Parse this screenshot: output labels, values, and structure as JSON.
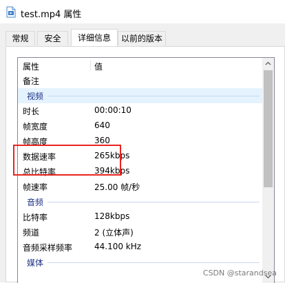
{
  "window": {
    "title": "test.mp4 属性",
    "icon": "video-file-icon"
  },
  "tabs": [
    {
      "label": "常规",
      "active": false
    },
    {
      "label": "安全",
      "active": false
    },
    {
      "label": "详细信息",
      "active": true
    },
    {
      "label": "以前的版本",
      "active": false
    }
  ],
  "details": {
    "columns": {
      "property": "属性",
      "value": "值"
    },
    "rows": {
      "remarks": {
        "name": "备注",
        "value": ""
      },
      "video_group": "视频",
      "duration": {
        "name": "时长",
        "value": "00:00:10"
      },
      "frame_width": {
        "name": "帧宽度",
        "value": "640"
      },
      "frame_height": {
        "name": "帧高度",
        "value": "360"
      },
      "data_rate": {
        "name": "数据速率",
        "value": "265kbps"
      },
      "total_bitrate": {
        "name": "总比特率",
        "value": "394kbps"
      },
      "frame_rate": {
        "name": "帧速率",
        "value": "25.00 帧/秒"
      },
      "audio_group": "音频",
      "bitrate": {
        "name": "比特率",
        "value": "128kbps"
      },
      "channels": {
        "name": "频道",
        "value": "2 (立体声)"
      },
      "sample_rate": {
        "name": "音频采样频率",
        "value": "44.100 kHz"
      },
      "media_group": "媒体"
    }
  },
  "colors": {
    "highlight": "#e8231f",
    "group_text": "#1e3287",
    "selected_row": "#e5f3ff"
  },
  "watermark": "CSDN @starandsea"
}
